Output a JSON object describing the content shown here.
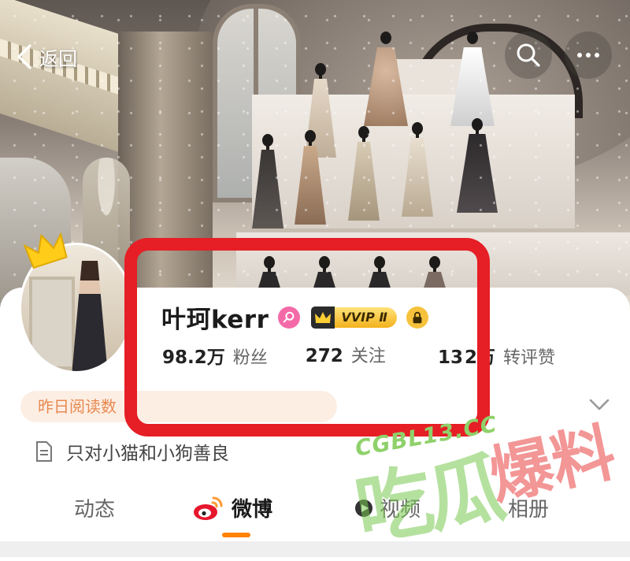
{
  "header": {
    "back_label": "返回",
    "icons": [
      "chevron-left-icon",
      "search-icon",
      "more-icon"
    ]
  },
  "profile": {
    "name": "叶珂kerr",
    "badges": {
      "gender": "female-icon",
      "vvip_label": "VVIP Ⅱ",
      "lock": "lock-icon"
    },
    "stats": [
      {
        "value": "98.2万",
        "label": "粉丝"
      },
      {
        "value": "272",
        "label": "关注"
      },
      {
        "value": "13",
        "value_tail": "2万",
        "label": "转评赞"
      }
    ],
    "yesterday_reads": "昨日阅读数",
    "bio": "只对小猫和小狗善良"
  },
  "tabs": [
    {
      "label": "动态"
    },
    {
      "label": "微博"
    },
    {
      "label": "视频"
    },
    {
      "label": "相册"
    }
  ],
  "active_tab": "微博",
  "watermark": {
    "url": "CGBL13.CC",
    "text_a": "吃瓜",
    "text_b": "爆料"
  },
  "colors": {
    "accent": "#ff8200",
    "highlight": "#e61e25",
    "read_pill_bg": "#fdeee4",
    "read_pill_text": "#e8894f",
    "gender_badge": "#f46aa8"
  }
}
